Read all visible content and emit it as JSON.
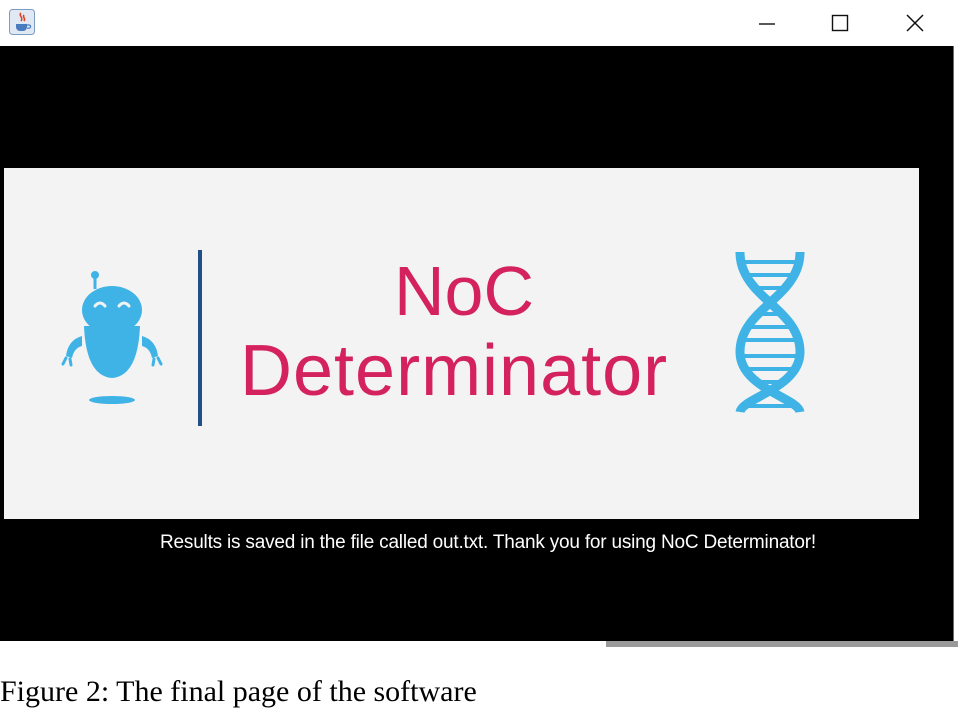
{
  "window": {
    "icon": "java-cup-icon",
    "controls": {
      "minimize": "minimize-icon",
      "maximize": "maximize-icon",
      "close": "close-icon"
    }
  },
  "banner": {
    "title_line1": "NoC",
    "title_line2": "Determinator",
    "colors": {
      "title": "#d4225e",
      "robot": "#3fb3e6",
      "divider": "#1f4f86",
      "dna": "#3fb3e6",
      "background": "#f3f3f4"
    }
  },
  "message": "Results is saved in the file called out.txt. Thank you for using NoC Determinator!",
  "caption": "Figure 2: The final page of the software"
}
